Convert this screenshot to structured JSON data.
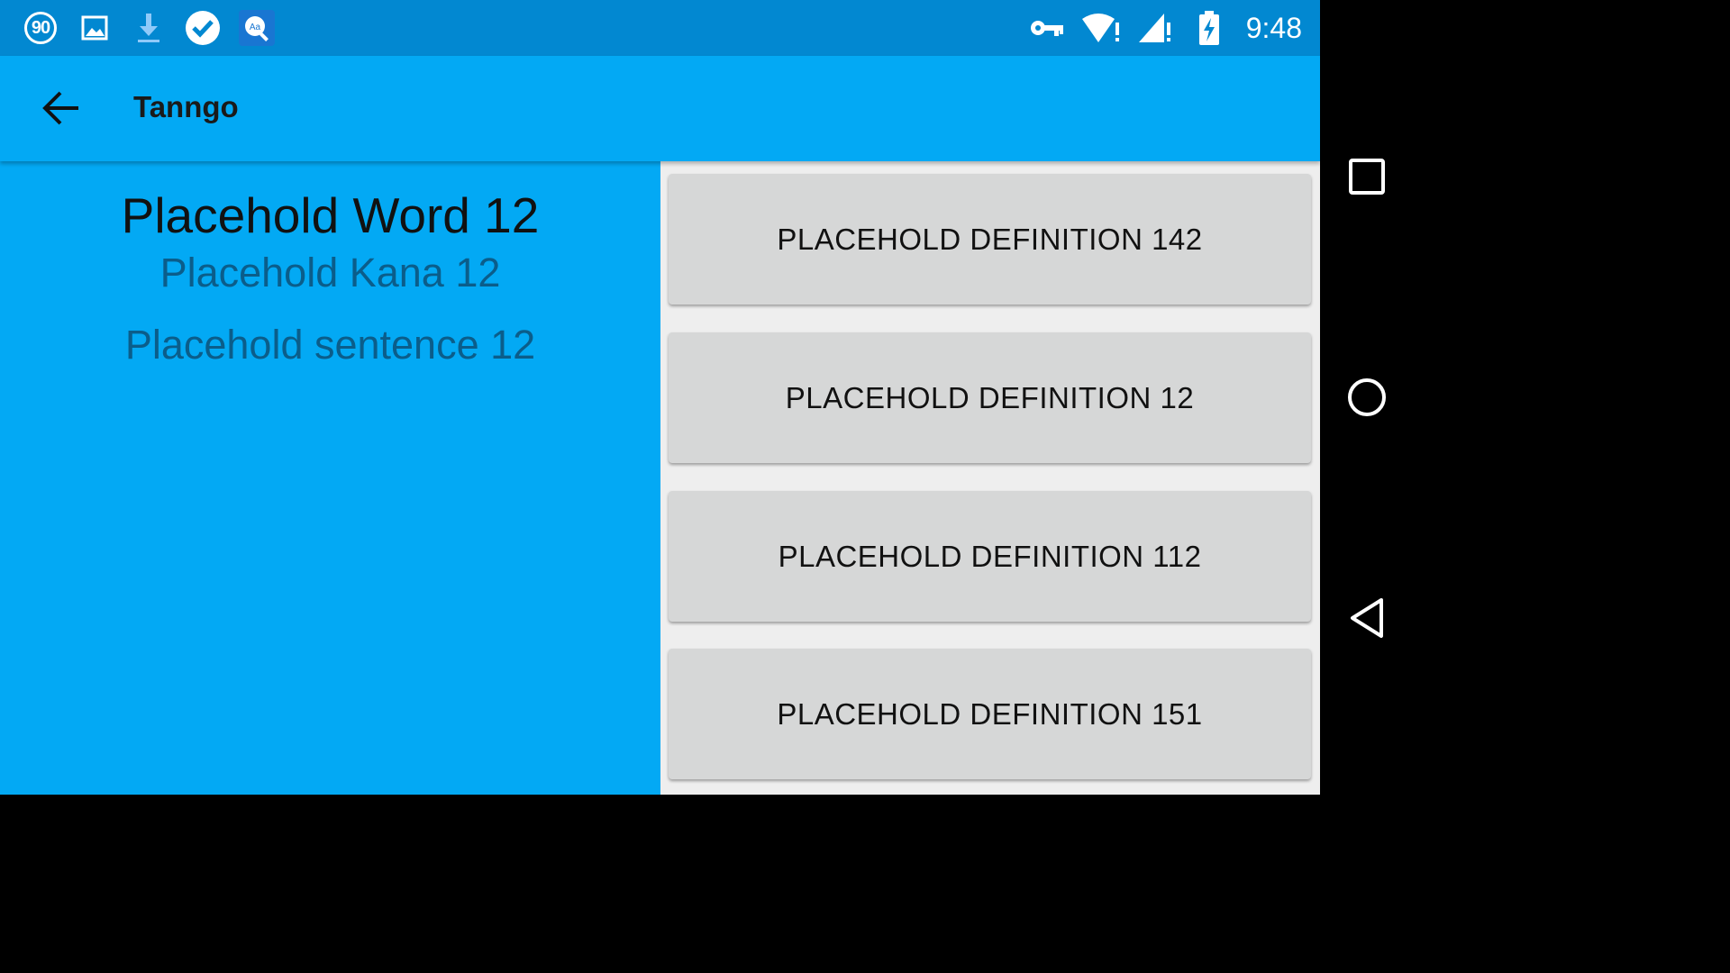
{
  "status_bar": {
    "notification_badge": "90",
    "time": "9:48",
    "icons_left": [
      "badge-90-icon",
      "image-icon",
      "download-icon",
      "check-circle-icon",
      "dictionary-search-icon"
    ],
    "icons_right": [
      "vpn-key-icon",
      "wifi-alert-icon",
      "signal-alert-icon",
      "battery-charging-icon"
    ]
  },
  "app_bar": {
    "title": "Tanngo",
    "back_icon": "arrow-back-icon"
  },
  "word_card": {
    "word": "Placehold Word 12",
    "kana": "Placehold Kana 12",
    "sentence": "Placehold sentence 12"
  },
  "definitions": [
    {
      "label": "PLACEHOLD DEFINITION 142"
    },
    {
      "label": "PLACEHOLD DEFINITION 12"
    },
    {
      "label": "PLACEHOLD DEFINITION 112"
    },
    {
      "label": "PLACEHOLD DEFINITION 151"
    }
  ],
  "nav_bar": {
    "buttons": [
      "recents-square-icon",
      "home-circle-icon",
      "back-triangle-icon"
    ]
  },
  "colors": {
    "primary": "#03A9F4",
    "primary_dark": "#0288D1",
    "button": "#D6D7D7",
    "pane_background": "#EEEEEE"
  }
}
